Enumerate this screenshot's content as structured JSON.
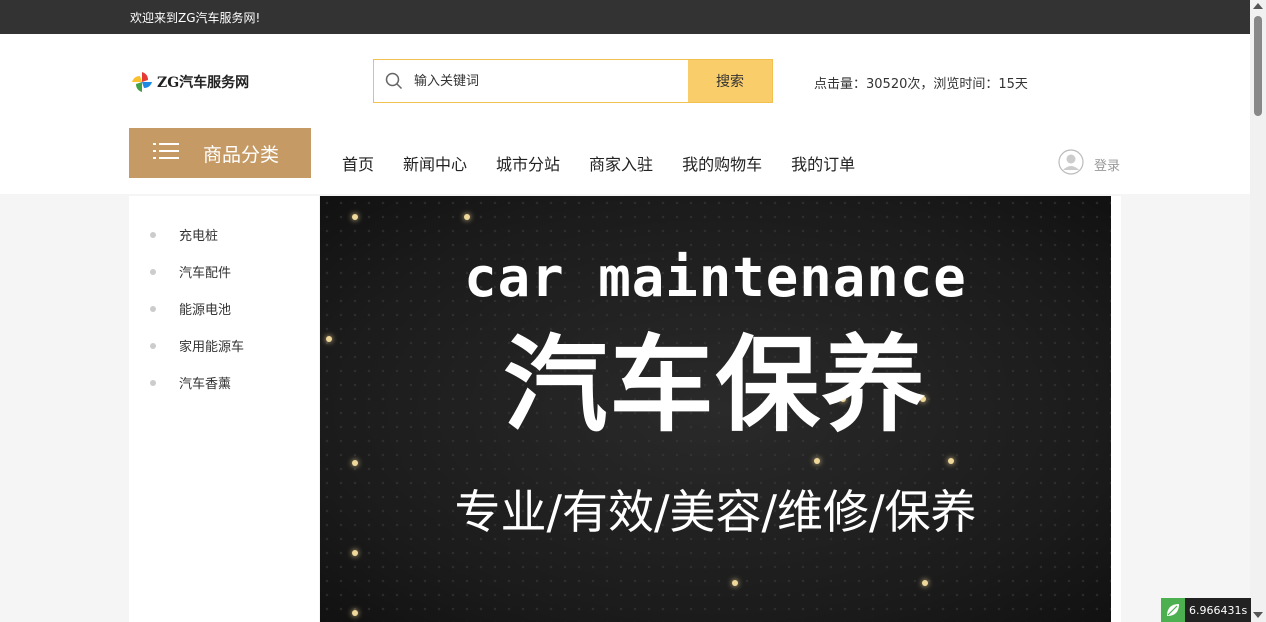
{
  "topbar": {
    "welcome": "欢迎来到ZG汽车服务网!"
  },
  "logo": {
    "text": "ZG汽车服务网",
    "icon": "pinwheel-logo-icon"
  },
  "search": {
    "placeholder": "输入关键词",
    "button": "搜索",
    "border_color": "#f2c04e",
    "button_color": "#f9cd6a"
  },
  "stats": "点击量：30520次，浏览时间：15天",
  "category_button": {
    "label": "商品分类",
    "icon": "menu-icon",
    "color": "#c59a65"
  },
  "nav": [
    {
      "label": "首页"
    },
    {
      "label": "新闻中心"
    },
    {
      "label": "城市分站"
    },
    {
      "label": "商家入驻"
    },
    {
      "label": "我的购物车"
    },
    {
      "label": "我的订单"
    }
  ],
  "login": {
    "label": "登录",
    "icon": "user-avatar-icon"
  },
  "sidebar": {
    "items": [
      {
        "label": "充电桩"
      },
      {
        "label": "汽车配件"
      },
      {
        "label": "能源电池"
      },
      {
        "label": "家用能源车"
      },
      {
        "label": "汽车香薰"
      }
    ]
  },
  "banner": {
    "title_en": "car maintenance",
    "title_zh": "汽车保养",
    "tagline": "专业/有效/美容/维修/保养"
  },
  "timer": {
    "value": "6.966431s"
  }
}
